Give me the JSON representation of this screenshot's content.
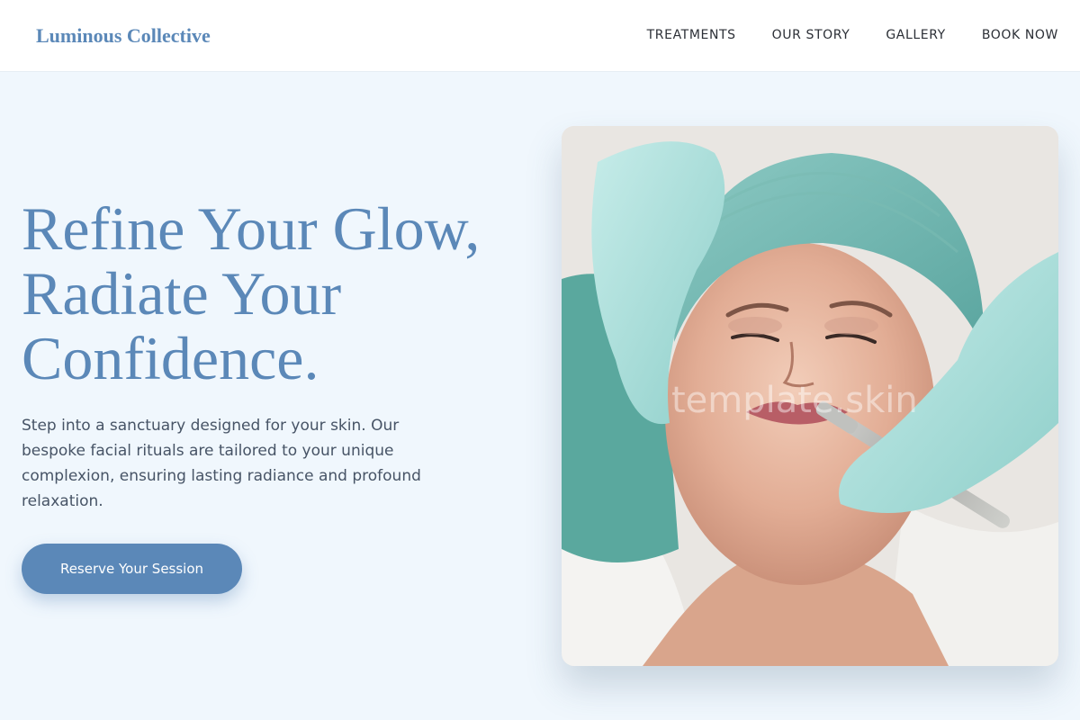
{
  "header": {
    "brand": "Luminous Collective",
    "nav": [
      {
        "label": "TREATMENTS"
      },
      {
        "label": "OUR STORY"
      },
      {
        "label": "GALLERY"
      },
      {
        "label": "BOOK NOW"
      }
    ]
  },
  "hero": {
    "title_lines": [
      "Refine Your Glow,",
      "Radiate Your",
      "Confidence."
    ],
    "description": "Step into a sanctuary designed for your skin. Our bespoke facial rituals are tailored to your unique complexion, ensuring lasting radiance and profound relaxation.",
    "cta_label": "Reserve Your Session",
    "image": {
      "subject": "facial-treatment-photo",
      "watermark": "template.skin"
    }
  },
  "colors": {
    "accent": "#5b88b8",
    "background": "#f0f7fd",
    "header_bg": "#ffffff",
    "nav_text": "#2b2f36",
    "body_text": "#475466"
  }
}
